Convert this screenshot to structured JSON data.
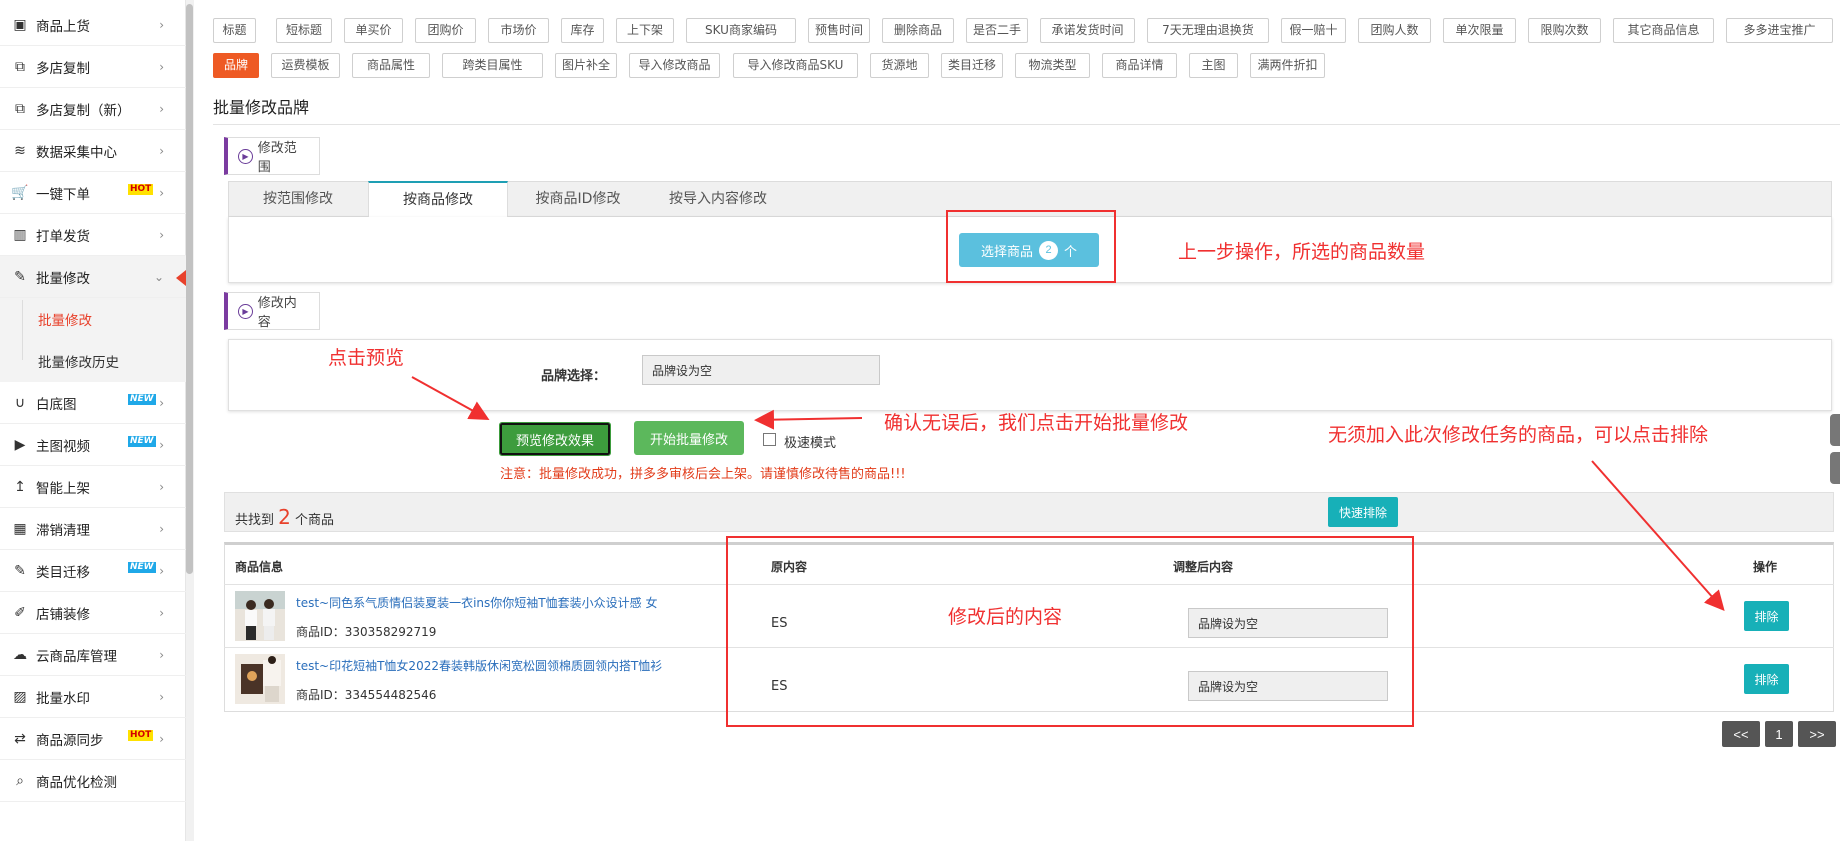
{
  "sidebar": {
    "items": [
      {
        "label": "商品上货",
        "icon": "tshirt-icon",
        "glyph": "▣"
      },
      {
        "label": "多店复制",
        "icon": "copy-icon",
        "glyph": "⧉"
      },
      {
        "label": "多店复制（新）",
        "icon": "copy-icon",
        "glyph": "⧉"
      },
      {
        "label": "数据采集中心",
        "icon": "database-icon",
        "glyph": "≋"
      },
      {
        "label": "一键下单",
        "icon": "cart-icon",
        "glyph": "🛒",
        "badge": "HOT"
      },
      {
        "label": "打单发货",
        "icon": "barcode-icon",
        "glyph": "▥"
      },
      {
        "label": "批量修改",
        "icon": "edit-icon",
        "glyph": "✎"
      },
      {
        "label": "白底图",
        "icon": "magnet-icon",
        "glyph": "∪",
        "badge": "NEW"
      },
      {
        "label": "主图视频",
        "icon": "play-icon",
        "glyph": "▶",
        "badge": "NEW"
      },
      {
        "label": "智能上架",
        "icon": "upload-icon",
        "glyph": "↥"
      },
      {
        "label": "滞销清理",
        "icon": "table-icon",
        "glyph": "▦"
      },
      {
        "label": "类目迁移",
        "icon": "edit-icon",
        "glyph": "✎",
        "badge": "NEW"
      },
      {
        "label": "店铺装修",
        "icon": "brush-icon",
        "glyph": "✐"
      },
      {
        "label": "云商品库管理",
        "icon": "cloud-icon",
        "glyph": "☁"
      },
      {
        "label": "批量水印",
        "icon": "image-icon",
        "glyph": "▨"
      },
      {
        "label": "商品源同步",
        "icon": "sync-icon",
        "glyph": "⇄",
        "badge": "HOT"
      },
      {
        "label": "商品优化检测",
        "icon": "search-icon",
        "glyph": "⌕"
      }
    ],
    "subitems": [
      "批量修改",
      "批量修改历史"
    ]
  },
  "tags_row1": [
    "标题",
    "短标题",
    "单买价",
    "团购价",
    "市场价",
    "库存",
    "上下架",
    "SKU商家编码",
    "预售时间",
    "删除商品",
    "是否二手",
    "承诺发货时间",
    "7天无理由退换货",
    "假一赔十",
    "团购人数",
    "单次限量",
    "限购次数",
    "其它商品信息",
    "多多进宝推广"
  ],
  "tags_row2": [
    "品牌",
    "运费模板",
    "商品属性",
    "跨类目属性",
    "图片补全",
    "导入修改商品",
    "导入修改商品SKU",
    "货源地",
    "类目迁移",
    "物流类型",
    "商品详情",
    "主图",
    "满两件折扣"
  ],
  "section_title": "批量修改品牌",
  "scope_label": "修改范围",
  "content_label": "修改内容",
  "tabs": [
    "按范围修改",
    "按商品修改",
    "按商品ID修改",
    "按导入内容修改"
  ],
  "select_button": {
    "text": "选择商品",
    "count": "2",
    "unit": "个"
  },
  "brand": {
    "label": "品牌选择：",
    "value": "品牌设为空"
  },
  "actions": {
    "preview": "预览修改效果",
    "start": "开始批量修改",
    "fast_mode": "极速模式"
  },
  "notice": "注意：批量修改成功，拼多多审核后会上架。请谨慎修改待售的商品!!!",
  "found": {
    "prefix": "共找到",
    "count": "2",
    "suffix": "个商品"
  },
  "quick_exclude": "快速排除",
  "table": {
    "headers": [
      "商品信息",
      "原内容",
      "调整后内容",
      "操作"
    ],
    "rows": [
      {
        "name": "test~同色系气质情侣装夏装一衣ins你你短袖T恤套装小众设计感 女",
        "id": "商品ID：330358292719",
        "original": "ES",
        "adjusted": "品牌设为空",
        "action": "排除"
      },
      {
        "name": "test~印花短袖T恤女2022春装韩版休闲宽松圆领棉质圆领内搭T恤衫",
        "id": "商品ID：334554482546",
        "original": "ES",
        "adjusted": "品牌设为空",
        "action": "排除"
      }
    ]
  },
  "pagination": [
    "<<",
    "1",
    ">>"
  ],
  "annotations": {
    "count": "上一步操作，所选的商品数量",
    "preview": "点击预览",
    "start": "确认无误后，我们点击开始批量修改",
    "exclude": "无须加入此次修改任务的商品，可以点击排除",
    "modified": "修改后的内容"
  },
  "colors": {
    "accent": "#ee5a24",
    "teal": "#17b0b8",
    "green": "#5cb85c",
    "annotation": "#f03030",
    "tab_active": "#1e9fb4"
  }
}
